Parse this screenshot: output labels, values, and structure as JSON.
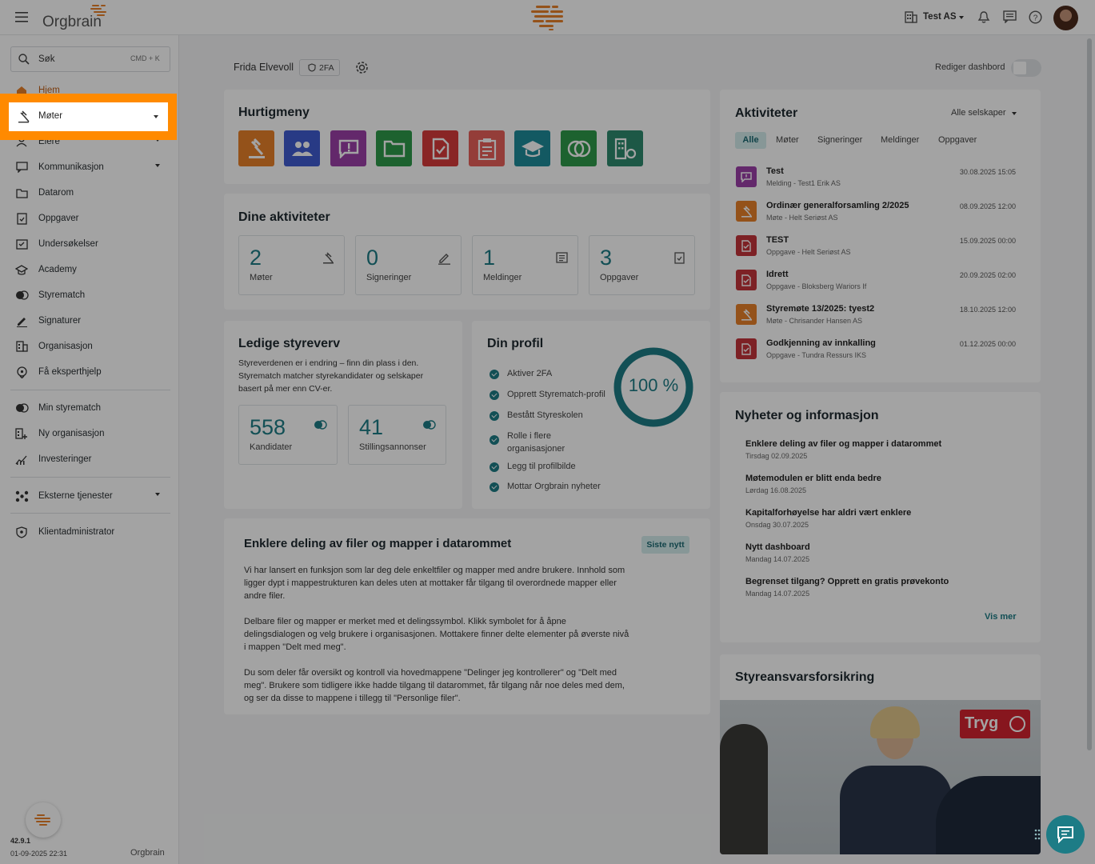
{
  "topbar": {
    "brand": "Orgbrain",
    "company": "Test AS"
  },
  "sidebar": {
    "search_label": "Søk",
    "search_shortcut": "CMD + K",
    "items": [
      {
        "label": "Hjem"
      },
      {
        "label": "Møter"
      },
      {
        "label": "Eiere"
      },
      {
        "label": "Kommunikasjon"
      },
      {
        "label": "Datarom"
      },
      {
        "label": "Oppgaver"
      },
      {
        "label": "Undersøkelser"
      },
      {
        "label": "Academy"
      },
      {
        "label": "Styrematch"
      },
      {
        "label": "Signaturer"
      },
      {
        "label": "Organisasjon"
      },
      {
        "label": "Få eksperthjelp"
      },
      {
        "label": "Min styrematch"
      },
      {
        "label": "Ny organisasjon"
      },
      {
        "label": "Investeringer"
      },
      {
        "label": "Eksterne tjenester"
      },
      {
        "label": "Klientadministrator"
      }
    ],
    "version": "42.9.1",
    "date": "01-09-2025 22:31",
    "footer_brand": "Orgbrain"
  },
  "header": {
    "user": "Frida Elvevoll",
    "twofa": "2FA",
    "edit_label": "Rediger dashbord"
  },
  "quick": {
    "title": "Hurtigmeny"
  },
  "activities": {
    "title": "Dine aktiviteter",
    "stats": [
      {
        "value": "2",
        "label": "Møter"
      },
      {
        "value": "0",
        "label": "Signeringer"
      },
      {
        "value": "1",
        "label": "Meldinger"
      },
      {
        "value": "3",
        "label": "Oppgaver"
      }
    ]
  },
  "boards": {
    "title": "Ledige styreverv",
    "text": "Styreverdenen er i endring – finn din plass i den. Styrematch matcher styrekandidater og selskaper basert på mer enn CV-er.",
    "stats": [
      {
        "value": "558",
        "label": "Kandidater"
      },
      {
        "value": "41",
        "label": "Stillingsannonser"
      }
    ]
  },
  "profile": {
    "title": "Din profil",
    "percent": "100 %",
    "percent_value": 100,
    "items": [
      "Aktiver 2FA",
      "Opprett Styrematch-profil",
      "Bestått Styreskolen",
      "Rolle i flere organisasjoner",
      "Legg til profilbilde",
      "Mottar Orgbrain nyheter"
    ]
  },
  "article": {
    "title": "Enklere deling av filer og mapper i datarommet",
    "badge": "Siste nytt",
    "p1": "Vi har lansert en funksjon som lar deg dele enkeltfiler og mapper med andre brukere. Innhold som ligger dypt i mappestrukturen kan deles uten at mottaker får tilgang til overordnede mapper eller andre filer.",
    "p2": "Delbare filer og mapper er merket med et delingssymbol. Klikk symbolet for å åpne delingsdialogen og velg brukere i organisasjonen. Mottakere finner delte elementer på øverste nivå i mappen \"Delt med meg\".",
    "p3": "Du som deler får oversikt og kontroll via hovedmappene \"Delinger jeg kontrollerer\" og \"Delt med meg\". Brukere som tidligere ikke hadde tilgang til datarommet, får tilgang når noe deles med dem, og ser da disse to mappene i tillegg til \"Personlige filer\"."
  },
  "feed": {
    "title": "Aktiviteter",
    "filter": "Alle selskaper",
    "tabs": [
      "Alle",
      "Møter",
      "Signeringer",
      "Meldinger",
      "Oppgaver"
    ],
    "items": [
      {
        "title": "Test",
        "sub": "Melding - Test1 Erik AS",
        "date": "30.08.2025 15:05",
        "kind": "message"
      },
      {
        "title": "Ordinær generalforsamling 2/2025",
        "sub": "Møte - Helt Seriøst AS",
        "date": "08.09.2025 12:00",
        "kind": "meeting"
      },
      {
        "title": "TEST",
        "sub": "Oppgave - Helt Seriøst AS",
        "date": "15.09.2025 00:00",
        "kind": "task"
      },
      {
        "title": "Idrett",
        "sub": "Oppgave - Bloksberg Wariors If",
        "date": "20.09.2025 02:00",
        "kind": "task"
      },
      {
        "title": "Styremøte 13/2025: tyest2",
        "sub": "Møte - Chrisander Hansen AS",
        "date": "18.10.2025 12:00",
        "kind": "meeting"
      },
      {
        "title": "Godkjenning av innkalling",
        "sub": "Oppgave - Tundra Ressurs IKS",
        "date": "01.12.2025 00:00",
        "kind": "task"
      }
    ]
  },
  "news": {
    "title": "Nyheter og informasjon",
    "more": "Vis mer",
    "items": [
      {
        "title": "Enklere deling av filer og mapper i datarommet",
        "date": "Tirsdag 02.09.2025"
      },
      {
        "title": "Møtemodulen er blitt enda bedre",
        "date": "Lørdag 16.08.2025"
      },
      {
        "title": "Kapitalforhøyelse har aldri vært enklere",
        "date": "Onsdag 30.07.2025"
      },
      {
        "title": "Nytt dashboard",
        "date": "Mandag 14.07.2025"
      },
      {
        "title": "Begrenset tilgang? Opprett en gratis prøvekonto",
        "date": "Mandag 14.07.2025"
      }
    ]
  },
  "insurance": {
    "title": "Styreansvarsforsikring",
    "brand": "Tryg"
  },
  "colors": {
    "accent": "#1d7c86",
    "orange": "#e8802a",
    "highlight": "#ff8a00"
  }
}
